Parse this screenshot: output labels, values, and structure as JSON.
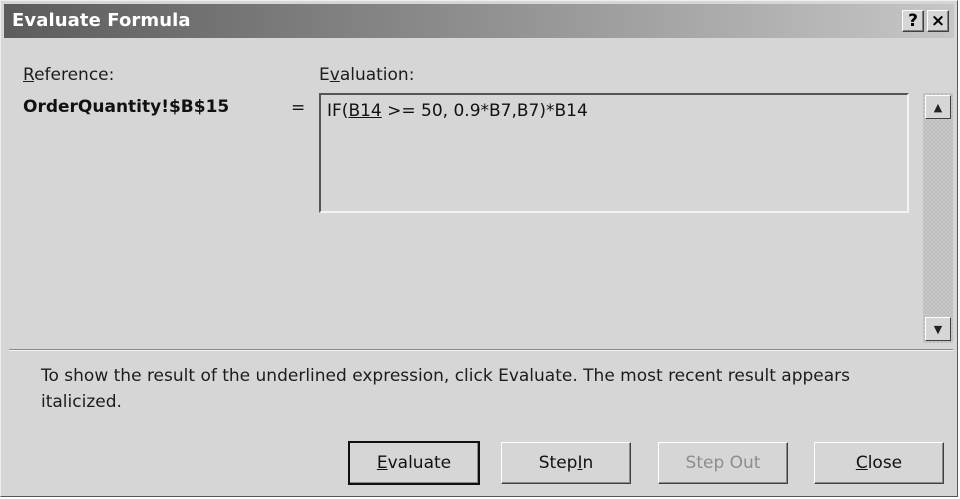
{
  "dialog": {
    "title": "Evaluate Formula",
    "help_label": "?",
    "close_label": "×"
  },
  "reference": {
    "label": "Reference:",
    "value": "OrderQuantity!$B$15",
    "equals": "="
  },
  "evaluation": {
    "label": "Evaluation:",
    "expr_prefix": "IF(",
    "expr_underlined": "B14",
    "expr_suffix": " >= 50, 0.9*B7,B7)*B14"
  },
  "scrollbar": {
    "up_icon": "scroll-up-arrow-icon",
    "down_icon": "scroll-down-arrow-icon"
  },
  "info": {
    "text": "To show the result of the underlined expression, click Evaluate.  The most recent result appears italicized."
  },
  "buttons": {
    "evaluate": "Evaluate",
    "step_in": "Step In",
    "step_out": "Step Out",
    "close": "Close"
  },
  "colors": {
    "dialog_bg": "#d6d6d6",
    "title_gradient_start": "#5c5c5c",
    "title_gradient_end": "#c6c6c6",
    "disabled_text": "#8d8d8d"
  }
}
